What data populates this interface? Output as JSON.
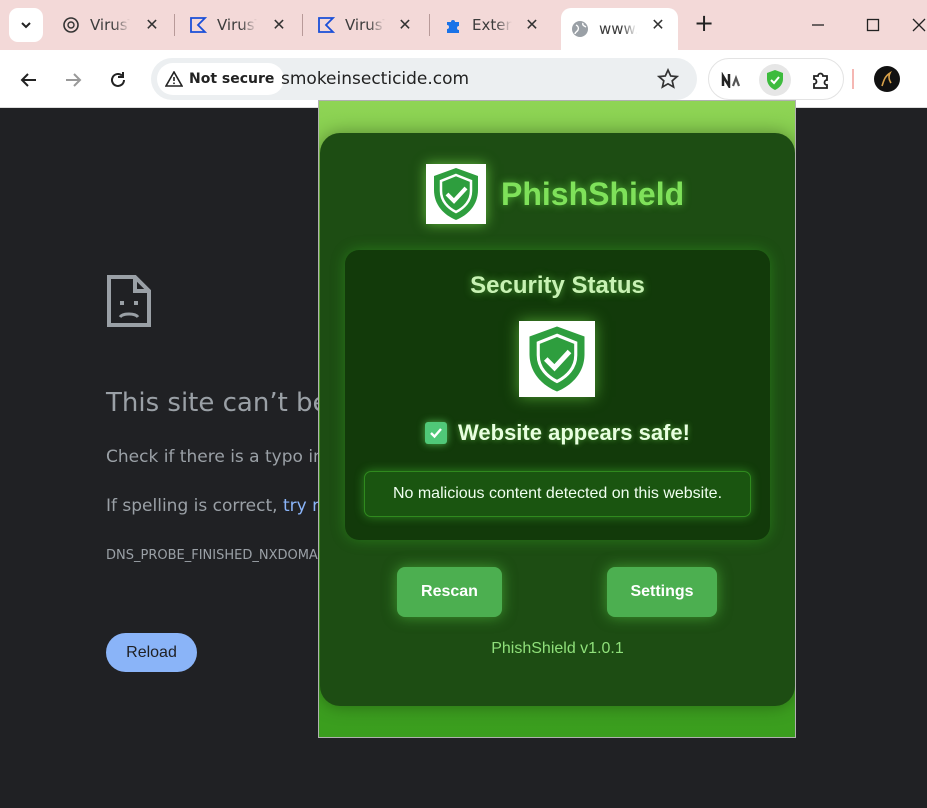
{
  "browser": {
    "tabs": [
      {
        "title": "VirusTotal",
        "icon": "openai-logo-icon"
      },
      {
        "title": "VirusTotal",
        "icon": "virustotal-icon"
      },
      {
        "title": "VirusTotal",
        "icon": "virustotal-icon"
      },
      {
        "title": "Extensions",
        "icon": "puzzle-icon"
      },
      {
        "title": "www.smokeinsecticide.com",
        "icon": "globe-icon",
        "active": true
      }
    ],
    "new_tab": "+",
    "security_chip": "Not secure",
    "url": "smokeinsecticide.com"
  },
  "error_page": {
    "title": "This site can’t be reached",
    "line1": "Check if there is a typo in",
    "line2_prefix": "If spelling is correct,",
    "line2_link": "try ru",
    "code": "DNS_PROBE_FINISHED_NXDOMAIN",
    "reload": "Reload"
  },
  "popup": {
    "brand": "PhishShield",
    "status_title": "Security Status",
    "status_message": "Website appears safe!",
    "detail": "No malicious content detected on this website.",
    "rescan": "Rescan",
    "settings": "Settings",
    "version": "PhishShield v1.0.1"
  },
  "colors": {
    "accent_green": "#4caf50",
    "panel_bg": "#1d4d13",
    "link_blue": "#8ab4f8"
  }
}
